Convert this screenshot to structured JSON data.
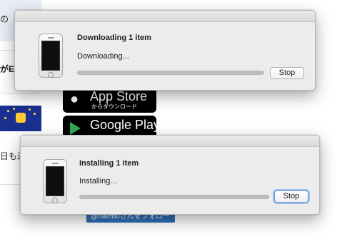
{
  "background": {
    "left_snippets": [
      "の",
      "がEU",
      "日も近"
    ],
    "app_store_badge": {
      "title": "App Store",
      "subtitle": "からダウンロード"
    },
    "google_play_badge": {
      "title": "Google Play"
    },
    "follow_button": {
      "label": "@hatebuさんをフォロー"
    }
  },
  "download_dialog": {
    "title": "Downloading 1 item",
    "status": "Downloading...",
    "progress": 1.0,
    "stop_label": "Stop"
  },
  "install_dialog": {
    "title": "Installing 1 item",
    "status": "Installing...",
    "progress": 1.0,
    "stop_label": "Stop"
  },
  "icons": {
    "device": "iphone-icon",
    "apple": "apple-icon",
    "google_play": "google-play-icon",
    "twitter": "twitter-icon"
  },
  "colors": {
    "dialog_bg": "#ececec",
    "focus_ring": "#9cc0ee",
    "follow_blue": "#2e6fb7"
  }
}
